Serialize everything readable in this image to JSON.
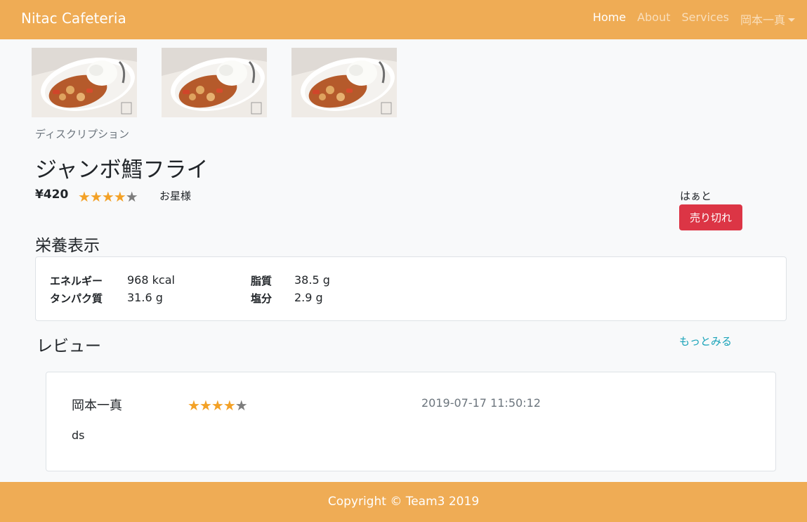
{
  "navbar": {
    "brand": "Nitac Cafeteria",
    "links": [
      {
        "label": "Home",
        "active": true
      },
      {
        "label": "About",
        "active": false
      },
      {
        "label": "Services",
        "active": false
      }
    ],
    "user_menu": "岡本一真"
  },
  "item": {
    "description_label": "ディスクリプション",
    "name": "ジャンボ鱈フライ",
    "price": "¥420",
    "rating": 4,
    "rating_max": 5,
    "rating_label": "お星様",
    "seller": "はぁと",
    "sold_out_label": "売り切れ",
    "image_alt": "curry-rice-photo"
  },
  "nutrition": {
    "heading": "栄養表示",
    "rows": [
      {
        "label": "エネルギー",
        "value": "968 kcal"
      },
      {
        "label": "タンパク質",
        "value": "31.6 g"
      },
      {
        "label": "脂質",
        "value": "38.5 g"
      },
      {
        "label": "塩分",
        "value": "2.9 g"
      }
    ]
  },
  "reviews": {
    "heading": "レビュー",
    "more_label": "もっとみる",
    "items": [
      {
        "author": "岡本一真",
        "rating": 4,
        "date": "2019-07-17 11:50:12",
        "body": "ds"
      }
    ]
  },
  "footer": {
    "text": "Copyright © Team3 2019"
  },
  "colors": {
    "navbar": "#efac55",
    "star": "#f3a126",
    "star_off": "#7d7d7d",
    "danger": "#dc3545",
    "link": "#17a2b8"
  },
  "icons": {
    "star": "★",
    "dropdown": "caret-down-icon"
  }
}
